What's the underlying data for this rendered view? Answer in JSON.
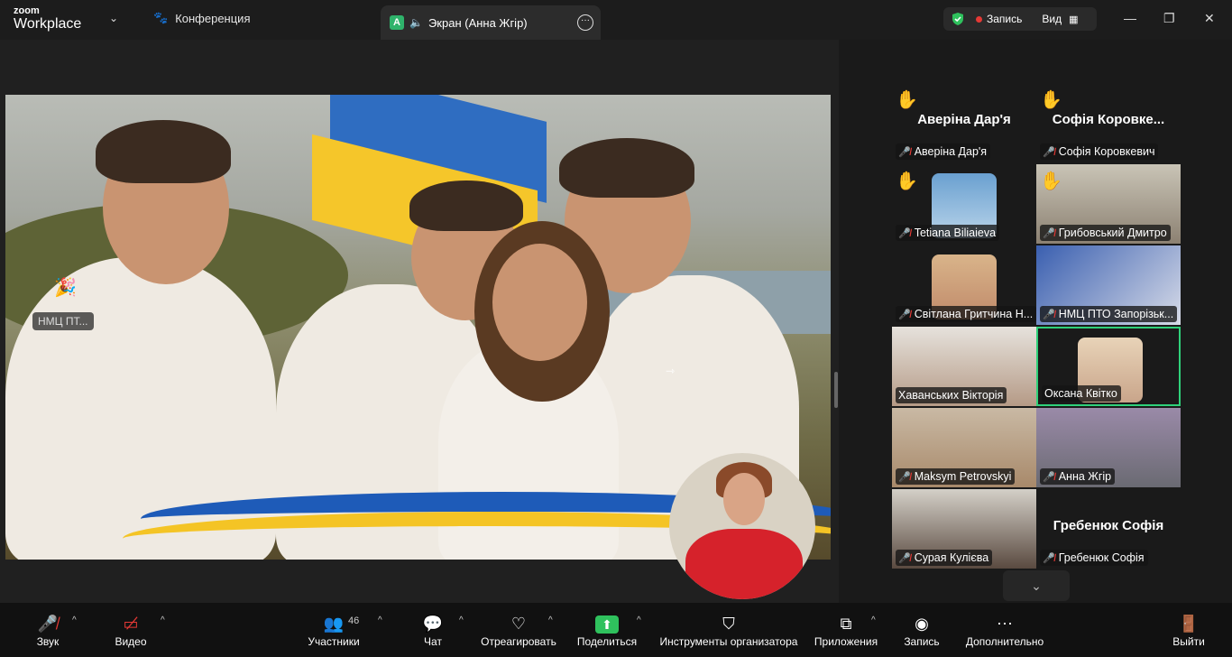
{
  "topbar": {
    "logo_small": "zoom",
    "logo_large": "Workplace",
    "conference_label": "Конференция",
    "screen_tab_letter": "A",
    "screen_tab_label": "Экран (Анна Жгір)",
    "record_label": "Запись",
    "view_label": "Вид"
  },
  "shared_screen": {
    "floating_label": "НМЦ ПТ..."
  },
  "gallery": {
    "tiles": [
      {
        "big_name": "Аверіна Дар'я",
        "label": "Аверіна Дар'я",
        "hand": true
      },
      {
        "big_name": "Софія  Коровке...",
        "label": "Софія Коровкевич",
        "hand": true
      },
      {
        "label": "Tetiana Biliaieva",
        "hand": true
      },
      {
        "label": "Грибовський Дмитро",
        "hand": true
      },
      {
        "label": "Світлана Гритчина Н..."
      },
      {
        "label": "НМЦ ПТО Запорізьк..."
      },
      {
        "label": "Хаванських Вікторія"
      },
      {
        "label": "Оксана Квітко"
      },
      {
        "label": "Maksym Petrovskyi"
      },
      {
        "label": "Анна Жгір"
      },
      {
        "label": "Сурая Кулієва"
      },
      {
        "big_name": "Гребенюк Софія",
        "label": "Гребенюк Софія"
      }
    ]
  },
  "toolbar": {
    "audio": "Звук",
    "video": "Видео",
    "participants": "Участники",
    "participants_count": "46",
    "chat": "Чат",
    "react": "Отреагировать",
    "share": "Поделиться",
    "host_tools": "Инструменты организатора",
    "apps": "Приложения",
    "record": "Запись",
    "more": "Дополнительно",
    "leave": "Выйти"
  },
  "colors": {
    "accent_green": "#2fd17a",
    "mute_red": "#e53935",
    "share_green": "#2fc15d"
  }
}
